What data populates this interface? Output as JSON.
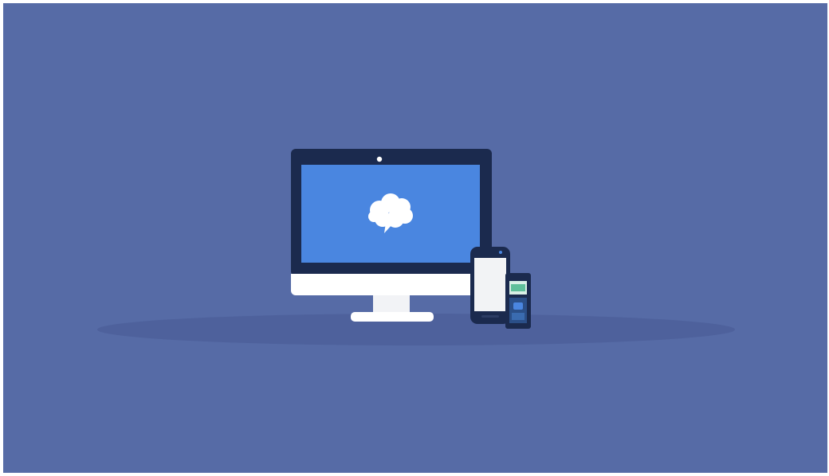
{
  "scene": {
    "description_icons": [
      "desktop-monitor-icon",
      "smartphone-icon",
      "feature-phone-icon",
      "brain-speech-bubble-icon"
    ],
    "colors": {
      "background": "#566ba6",
      "shadow": "#4e619c",
      "bezel": "#1b2a4e",
      "screen": "#4a86e0",
      "chin": "#ffffff",
      "phone_screen": "#f2f3f5",
      "accent_green": "#5fbf9a"
    }
  }
}
